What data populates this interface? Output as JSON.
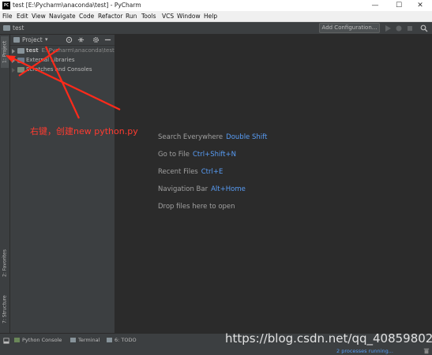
{
  "window": {
    "title": "test [E:\\Pycharm\\anaconda\\test] - PyCharm",
    "app_icon": "PC",
    "minimize_glyph": "—",
    "maximize_glyph": "☐",
    "close_glyph": "✕"
  },
  "menu": [
    "File",
    "Edit",
    "View",
    "Navigate",
    "Code",
    "Refactor",
    "Run",
    "Tools",
    "VCS",
    "Window",
    "Help"
  ],
  "navbar": {
    "breadcrumb": "test",
    "add_configuration": "Add Configuration..."
  },
  "project_panel": {
    "title": "Project",
    "tree": [
      {
        "label": "test",
        "path": "E:\\Pycharm\\anaconda\\test",
        "icon": "folder-icon"
      },
      {
        "label": "External Libraries",
        "path": "",
        "icon": "library-icon"
      },
      {
        "label": "Scratches and Consoles",
        "path": "",
        "icon": "scratches-icon"
      }
    ]
  },
  "side_tabs": {
    "project": "1: Project",
    "favorites": "2: Favorites",
    "structure": "7: Structure"
  },
  "editor_hints": [
    {
      "label": "Search Everywhere",
      "key": "Double Shift"
    },
    {
      "label": "Go to File",
      "key": "Ctrl+Shift+N"
    },
    {
      "label": "Recent Files",
      "key": "Ctrl+E"
    },
    {
      "label": "Navigation Bar",
      "key": "Alt+Home"
    },
    {
      "label": "Drop files here to open",
      "key": ""
    }
  ],
  "bottom_tabs": [
    "Python Console",
    "Terminal",
    "6: TODO"
  ],
  "status": {
    "processes": "2 processes running..."
  },
  "annotation": "右键，创建new python.py",
  "watermark": "https://blog.csdn.net/qq_40859802",
  "colors": {
    "accent": "#589df6",
    "annotation": "#ff3b30",
    "panel_bg": "#3c3f41",
    "editor_bg": "#2b2b2b"
  }
}
